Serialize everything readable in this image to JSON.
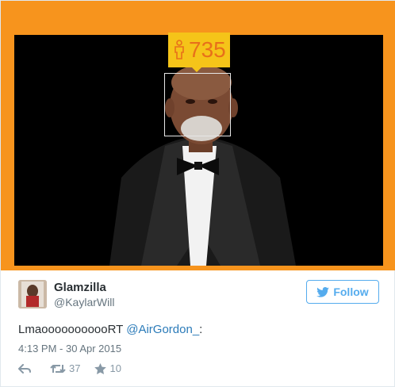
{
  "age_overlay": {
    "value": "735",
    "badge_color": "#f5c419",
    "text_color": "#e8701a",
    "icon": "person-icon"
  },
  "tweet": {
    "display_name": "Glamzilla",
    "handle": "@KaylarWill",
    "follow_label": "Follow",
    "text_prefix": "LmaooooooooooRT ",
    "mention": "@AirGordon_",
    "text_suffix": ":",
    "timestamp": "4:13 PM - 30 Apr 2015",
    "retweet_count": "37",
    "favorite_count": "10"
  },
  "colors": {
    "frame_orange": "#f7941d",
    "twitter_blue": "#55acee",
    "link_blue": "#2b7bb9"
  }
}
